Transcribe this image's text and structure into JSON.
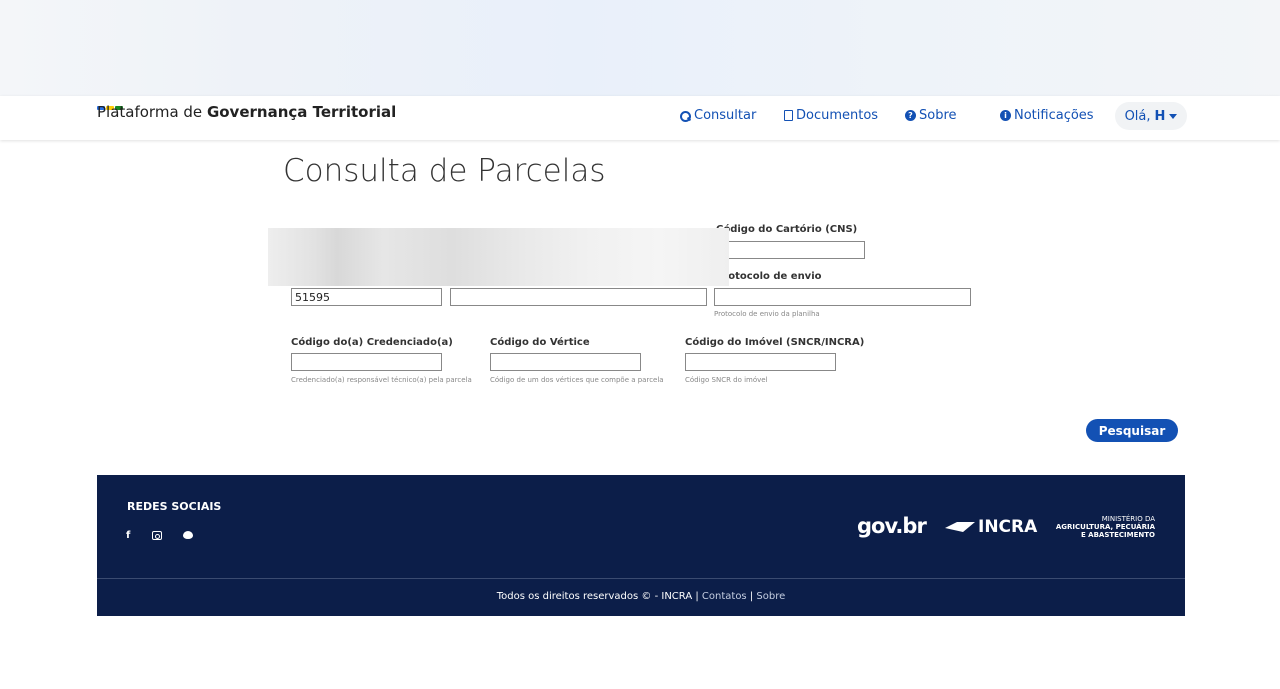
{
  "header": {
    "brand_prefix": "Plataforma de ",
    "brand_bold": "Governança Territorial",
    "nav": {
      "consultar": "Consultar",
      "documentos": "Documentos",
      "sobre": "Sobre",
      "notificacoes": "Notificações"
    },
    "user_greeting": "Olá,",
    "user_initial": "H"
  },
  "page": {
    "title": "Consulta de Parcelas"
  },
  "form": {
    "cartorio": {
      "label": "Código do Cartório (CNS)",
      "value": ""
    },
    "field_a": {
      "value": "51595"
    },
    "field_b": {
      "value": ""
    },
    "protocolo": {
      "label": "Protocolo de envio",
      "value": "",
      "help": "Protocolo de envio da planilha"
    },
    "credenciado": {
      "label": "Código do(a) Credenciado(a)",
      "value": "",
      "help": "Credenciado(a) responsável técnico(a) pela parcela"
    },
    "vertice": {
      "label": "Código do Vértice",
      "value": "",
      "help": "Código de um dos vértices que compõe a parcela"
    },
    "imovel": {
      "label": "Código do Imóvel (SNCR/INCRA)",
      "value": "",
      "help": "Código SNCR do imóvel"
    },
    "submit_label": "Pesquisar"
  },
  "footer": {
    "social_title": "REDES SOCIAIS",
    "social_icons": [
      "facebook-icon",
      "instagram-icon",
      "twitter-icon"
    ],
    "logo_govbr": "gov.br",
    "logo_incra": "INCRA",
    "ministerio_line1": "MINISTÉRIO DA",
    "ministerio_line2": "AGRICULTURA, PECUÁRIA",
    "ministerio_line3": "E ABASTECIMENTO",
    "copyright": "Todos os direitos reservados © - INCRA |",
    "link_contatos": "Contatos",
    "separator": "|",
    "link_sobre": "Sobre"
  },
  "colors": {
    "primary": "#1351b4",
    "footer_bg": "#0c1e49"
  }
}
